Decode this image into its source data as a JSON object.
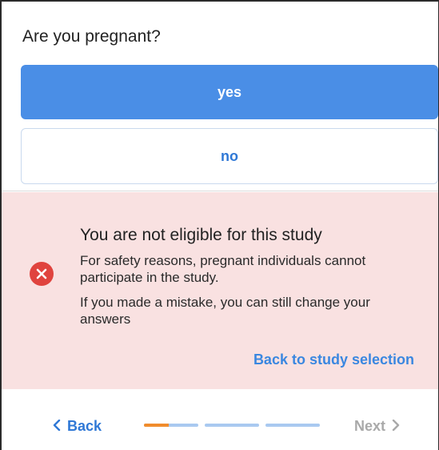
{
  "question": {
    "text": "Are you pregnant?"
  },
  "options": [
    {
      "label": "yes",
      "selected": true
    },
    {
      "label": "no",
      "selected": false
    }
  ],
  "alert": {
    "icon": "error-x-icon",
    "title": "You are not eligible for this study",
    "message_1": "For safety reasons, pregnant individuals cannot participate in the study.",
    "message_2": "If you made a mistake, you can still change your answers",
    "link_label": "Back to study selection"
  },
  "footer": {
    "back_label": "Back",
    "next_label": "Next",
    "progress_segments": 3,
    "progress_fraction_of_first_segment": 0.45
  },
  "colors": {
    "accent": "#4a8ee6",
    "alert_background": "#f9e1e1",
    "error": "#e0433e",
    "progress_done": "#f08c2d",
    "progress_track": "#a9c9f0"
  }
}
